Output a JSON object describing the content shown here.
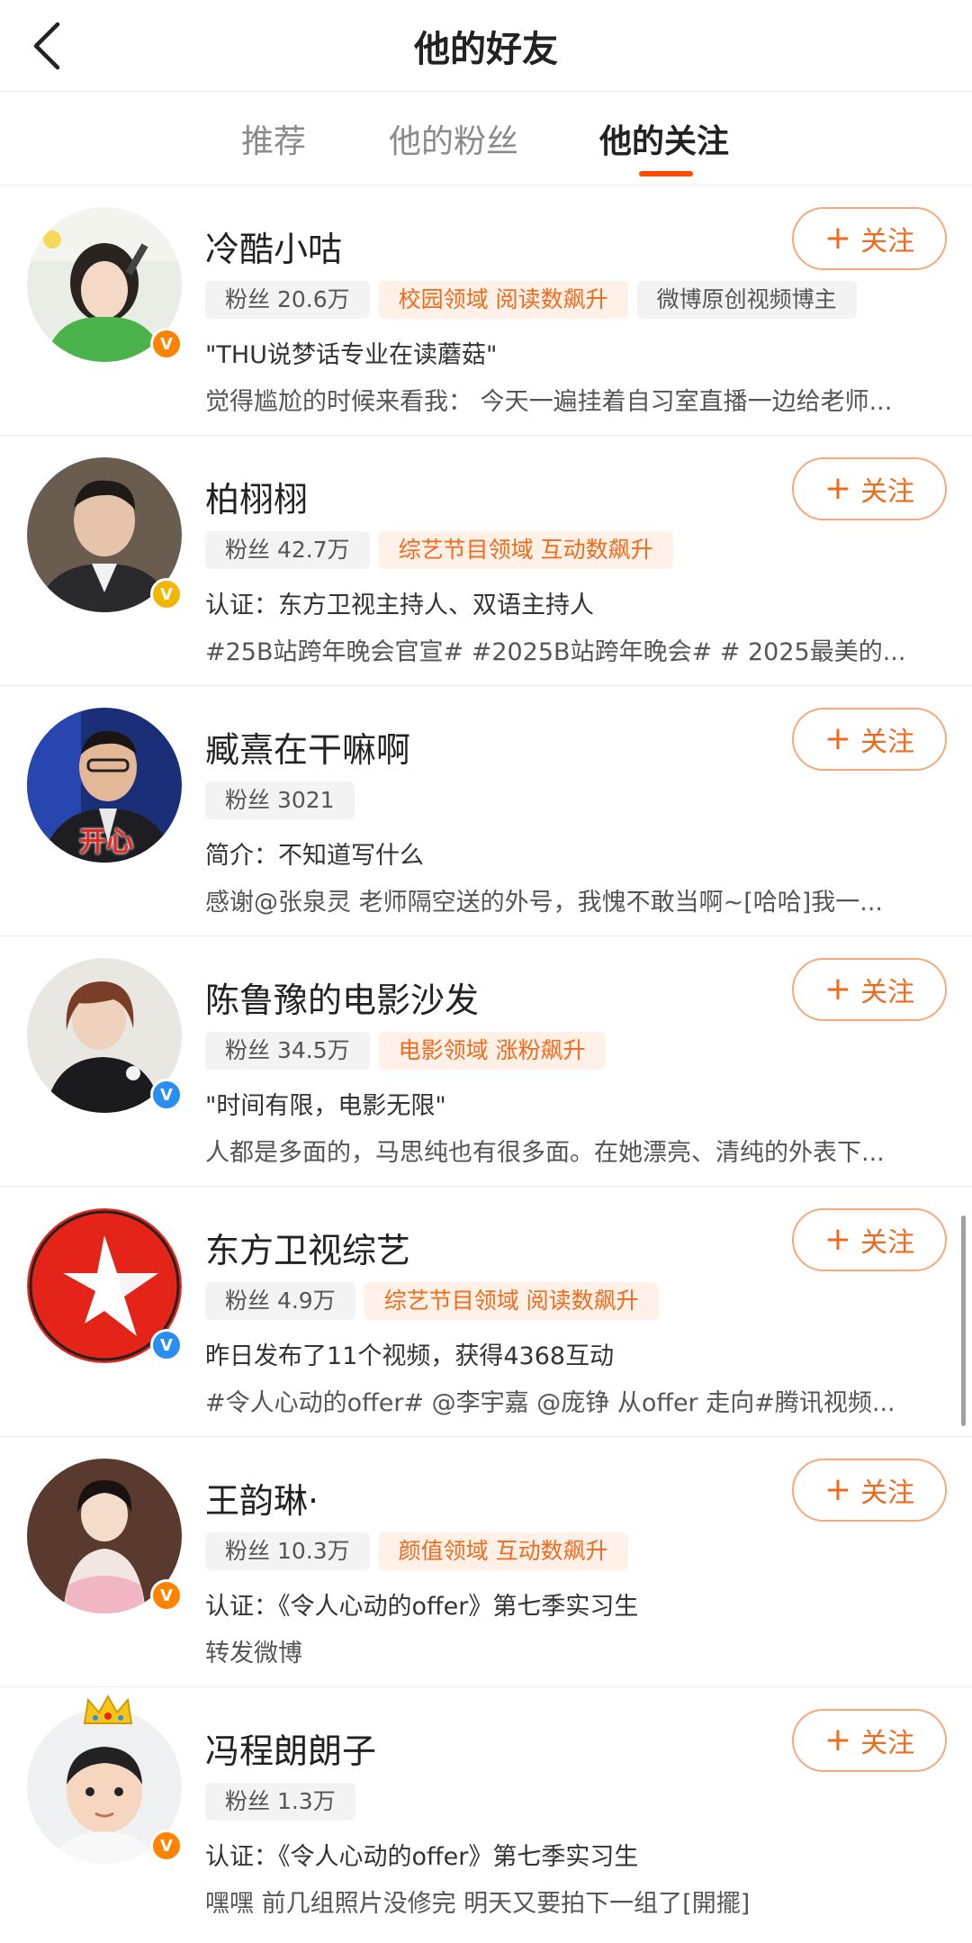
{
  "header": {
    "title": "他的好友"
  },
  "tabs": [
    {
      "label": "推荐"
    },
    {
      "label": "他的粉丝"
    },
    {
      "label": "他的关注"
    }
  ],
  "follow_label": "关注",
  "users": [
    {
      "name": "冷酷小咕",
      "tags": [
        {
          "text": "粉丝 20.6万",
          "style": "gray"
        },
        {
          "text": "校园领域 阅读数飙升",
          "style": "orange"
        },
        {
          "text": "微博原创视频博主",
          "style": "gray"
        }
      ],
      "line1": "\"THU说梦话专业在读蘑菇\"",
      "line2": "觉得尴尬的时候来看我：  今天一遍挂着自习室直播一边给老师...",
      "verify_badge": "orange"
    },
    {
      "name": "柏栩栩",
      "tags": [
        {
          "text": "粉丝 42.7万",
          "style": "gray"
        },
        {
          "text": "综艺节目领域 互动数飙升",
          "style": "orange"
        }
      ],
      "line1": "认证：东方卫视主持人、双语主持人",
      "line2": "#25B站跨年晚会官宣# #2025B站跨年晚会# # 2025最美的...",
      "verify_badge": "yellow"
    },
    {
      "name": "臧熹在干嘛啊",
      "tags": [
        {
          "text": "粉丝 3021",
          "style": "gray"
        }
      ],
      "line1": "简介：不知道写什么",
      "line2": "感谢@张泉灵 老师隔空送的外号，我愧不敢当啊~[哈哈]我一...",
      "verify_badge": "",
      "avatar_caption": "开心"
    },
    {
      "name": "陈鲁豫的电影沙发",
      "tags": [
        {
          "text": "粉丝 34.5万",
          "style": "gray"
        },
        {
          "text": "电影领域 涨粉飙升",
          "style": "orange"
        }
      ],
      "line1": "\"时间有限，电影无限\"",
      "line2": "人都是多面的，马思纯也有很多面。在她漂亮、清纯的外表下...",
      "verify_badge": "blue"
    },
    {
      "name": "东方卫视综艺",
      "tags": [
        {
          "text": "粉丝 4.9万",
          "style": "gray"
        },
        {
          "text": "综艺节目领域 阅读数飙升",
          "style": "orange"
        }
      ],
      "line1": "昨日发布了11个视频，获得4368互动",
      "line2": "#令人心动的offer# @李宇嘉 @庞铮 从offer 走向#腾讯视频...",
      "verify_badge": "blue"
    },
    {
      "name": "王韵琳·",
      "tags": [
        {
          "text": "粉丝 10.3万",
          "style": "gray"
        },
        {
          "text": "颜值领域 互动数飙升",
          "style": "orange"
        }
      ],
      "line1": "认证：《令人心动的offer》第七季实习生",
      "line2": "转发微博",
      "verify_badge": "orange"
    },
    {
      "name": "冯程朗朗子",
      "tags": [
        {
          "text": "粉丝 1.3万",
          "style": "gray"
        }
      ],
      "line1": "认证：《令人心动的offer》第七季实习生",
      "line2": "嘿嘿 前几组照片没修完 明天又要拍下一组了[開擺]",
      "verify_badge": "orange"
    }
  ],
  "colors": {
    "accent": "#ff4a00",
    "follow_text": "#f06a1c",
    "follow_border": "#f5a97c",
    "tag_orange_bg": "#fff1e8",
    "tag_gray_bg": "#f3f3f3"
  }
}
